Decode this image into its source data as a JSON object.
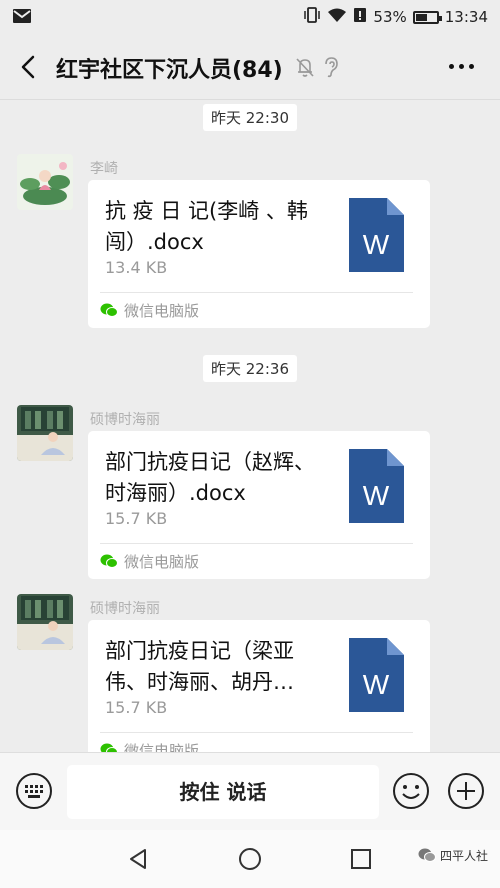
{
  "status_bar": {
    "battery_percent": "53%",
    "time": "13:34"
  },
  "header": {
    "title": "红宇社区下沉人员(84)"
  },
  "messages": [
    {
      "timestamp": "昨天 22:30",
      "sender": "李崎",
      "file_name": "抗 疫 日 记(李崎 、韩闯）.docx",
      "file_size": "13.4 KB",
      "source": "微信电脑版"
    },
    {
      "timestamp": "昨天 22:36",
      "sender": "硕博时海丽",
      "file_name": "部门抗疫日记（赵辉、时海丽）.docx",
      "file_size": "15.7 KB",
      "source": "微信电脑版"
    },
    {
      "sender": "硕博时海丽",
      "file_name": "部门抗疫日记（梁亚伟、时海丽、胡丹…",
      "file_size": "15.7 KB",
      "source": "微信电脑版"
    }
  ],
  "input_bar": {
    "hold_to_talk": "按住 说话"
  },
  "watermark": "四平人社",
  "colors": {
    "background": "#ededed",
    "word_blue": "#2b5797",
    "wechat_green": "#2dc100"
  }
}
